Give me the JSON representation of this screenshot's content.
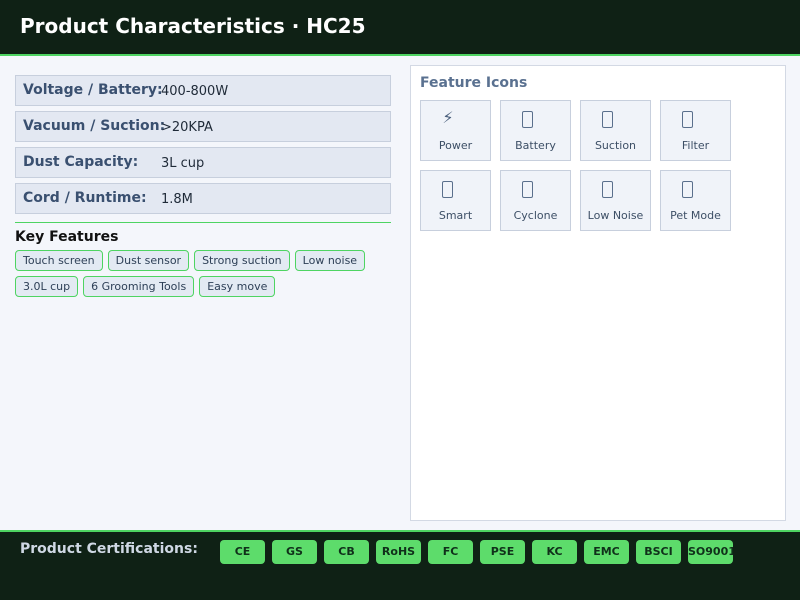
{
  "header": {
    "title": "Product Characteristics  ·  HC25"
  },
  "specs": [
    {
      "label": "Voltage / Battery:",
      "value": "400-800W"
    },
    {
      "label": "Vacuum / Suction:",
      "value": ">20KPA"
    },
    {
      "label": "Dust Capacity:",
      "value": "3L cup"
    },
    {
      "label": "Cord / Runtime:",
      "value": "1.8M"
    }
  ],
  "key_features": {
    "title": "Key Features",
    "items": [
      "Touch screen",
      "Dust sensor",
      "Strong suction",
      "Low noise",
      "3.0L cup",
      "6 Grooming Tools",
      "Easy move"
    ]
  },
  "feature_icons": {
    "title": "Feature Icons",
    "items": [
      {
        "icon": "lightning-icon",
        "glyph": "⚡",
        "label": "Power"
      },
      {
        "icon": "battery-icon",
        "glyph": "",
        "label": "Battery"
      },
      {
        "icon": "suction-icon",
        "glyph": "",
        "label": "Suction"
      },
      {
        "icon": "filter-icon",
        "glyph": "",
        "label": "Filter"
      },
      {
        "icon": "smart-icon",
        "glyph": "",
        "label": "Smart"
      },
      {
        "icon": "cyclone-icon",
        "glyph": "",
        "label": "Cyclone"
      },
      {
        "icon": "low-noise-icon",
        "glyph": "",
        "label": "Low Noise"
      },
      {
        "icon": "pet-mode-icon",
        "glyph": "",
        "label": "Pet Mode"
      }
    ]
  },
  "certifications": {
    "title": "Product Certifications:",
    "items": [
      "CE",
      "GS",
      "CB",
      "RoHS",
      "FC",
      "PSE",
      "KC",
      "EMC",
      "BSCI",
      "SO9001"
    ]
  },
  "colors": {
    "header_bg": "#0f2115",
    "accent_green": "#4ed462",
    "badge_green": "#5ddc6b",
    "label_blue": "#3a5070"
  }
}
